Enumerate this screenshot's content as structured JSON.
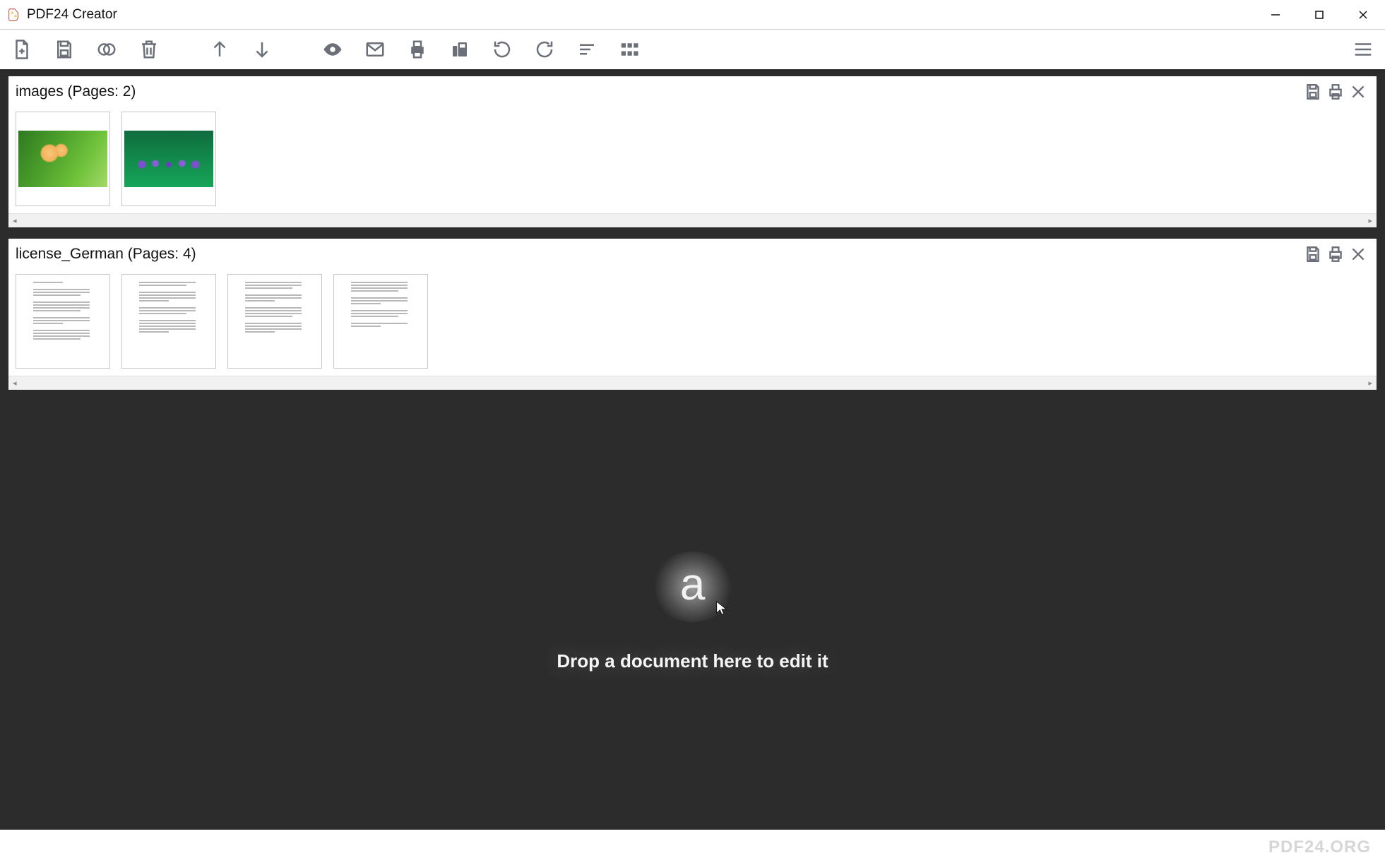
{
  "app": {
    "title": "PDF24 Creator"
  },
  "documents": [
    {
      "name": "images",
      "pages_label": "(Pages: 2)",
      "thumbs": [
        {
          "kind": "image",
          "style": "img1"
        },
        {
          "kind": "image",
          "style": "img2"
        }
      ]
    },
    {
      "name": "license_German",
      "pages_label": "(Pages: 4)",
      "thumbs": [
        {
          "kind": "text"
        },
        {
          "kind": "text"
        },
        {
          "kind": "text"
        },
        {
          "kind": "text"
        }
      ]
    }
  ],
  "dropzone": {
    "glyph": "a",
    "text": "Drop a document here to edit it"
  },
  "footer": {
    "brand": "PDF24.ORG"
  },
  "toolbar_icons": {
    "new": "new-file-icon",
    "save": "save-icon",
    "merge": "merge-icon",
    "delete": "trash-icon",
    "up": "arrow-up-icon",
    "down": "arrow-down-icon",
    "preview": "eye-icon",
    "email": "mail-icon",
    "print": "print-icon",
    "fax": "fax-icon",
    "rotate_left": "rotate-ccw-icon",
    "rotate_right": "rotate-cw-icon",
    "sort": "sort-icon",
    "grid": "grid-icon",
    "menu": "menu-icon"
  }
}
